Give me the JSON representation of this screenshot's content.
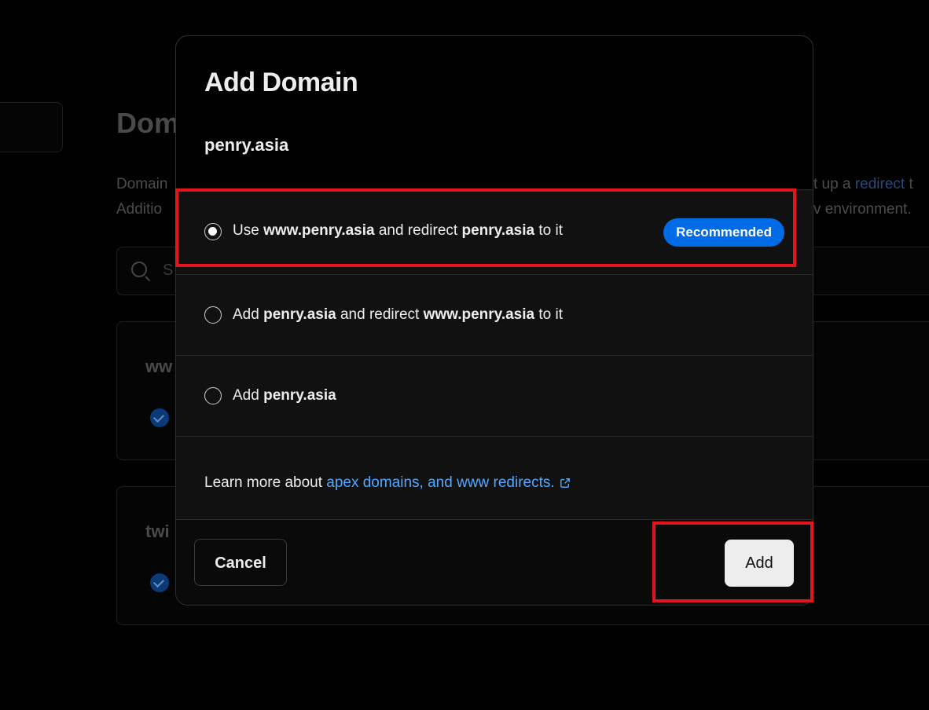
{
  "background": {
    "title": "Dom",
    "desc_line1": "Domain",
    "desc_line2": "Additio",
    "desc_right_line1_prefix": "t up a ",
    "desc_right_line1_link": "redirect",
    "desc_right_line1_suffix": " t",
    "desc_right_line2": "v environment.",
    "search_placeholder": "S",
    "cards": [
      {
        "name": "ww"
      },
      {
        "name": "twi"
      }
    ]
  },
  "modal": {
    "title": "Add Domain",
    "domain": "penry.asia",
    "options": [
      {
        "selected": true,
        "parts": [
          {
            "text": "Use ",
            "bold": false
          },
          {
            "text": "www.penry.asia",
            "bold": true
          },
          {
            "text": " and redirect ",
            "bold": false
          },
          {
            "text": "penry.asia",
            "bold": true
          },
          {
            "text": " to it",
            "bold": false
          }
        ],
        "badge": "Recommended"
      },
      {
        "selected": false,
        "parts": [
          {
            "text": "Add ",
            "bold": false
          },
          {
            "text": "penry.asia",
            "bold": true
          },
          {
            "text": " and redirect ",
            "bold": false
          },
          {
            "text": "www.penry.asia",
            "bold": true
          },
          {
            "text": " to it",
            "bold": false
          }
        ]
      },
      {
        "selected": false,
        "parts": [
          {
            "text": "Add ",
            "bold": false
          },
          {
            "text": "penry.asia",
            "bold": true
          }
        ]
      }
    ],
    "learn_more_prefix": "Learn more about ",
    "learn_more_link": "apex domains, and www redirects.",
    "cancel_label": "Cancel",
    "add_label": "Add"
  },
  "colors": {
    "accent_blue": "#006be6",
    "link_blue": "#52a8ff",
    "highlight_red": "#e0161c"
  },
  "icons": {
    "external_link": "external-link-icon",
    "search": "search-icon",
    "check": "check-circle-icon"
  }
}
